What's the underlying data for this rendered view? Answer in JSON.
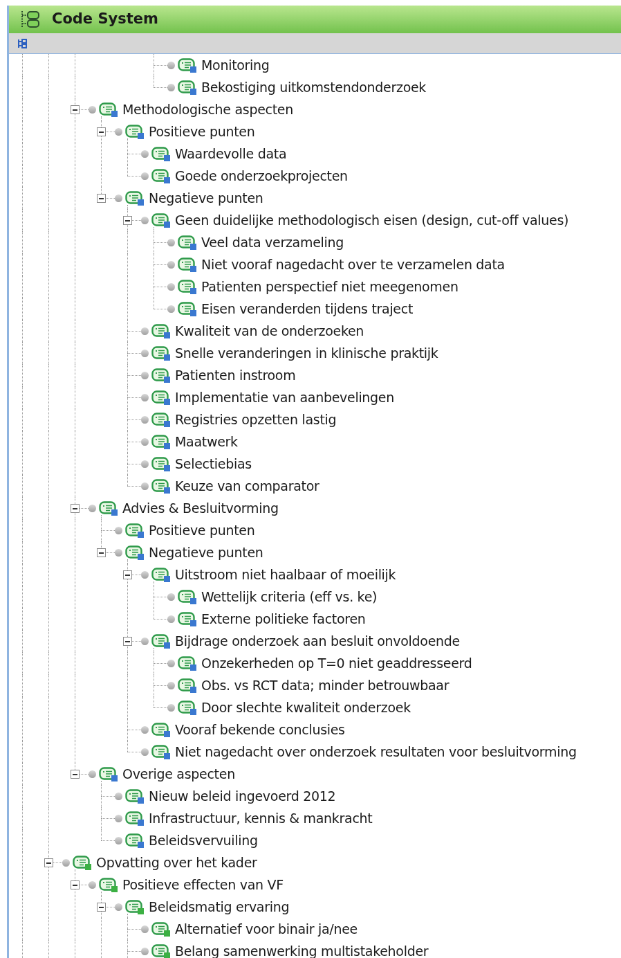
{
  "panel": {
    "title": "Code System"
  },
  "tree": [
    {
      "children": [
        {
          "children": [
            {
              "children": [
                {
                  "children": [
                    {
                      "children": [
                        {
                          "label": "Monitoring",
                          "color": "#3a78d0"
                        },
                        {
                          "label": "Bekostiging uitkomstendonderzoek",
                          "color": "#3a78d0"
                        }
                      ]
                    }
                  ]
                }
              ]
            },
            {
              "label": "Methodologische aspecten",
              "color": "#3a78d0",
              "expanded": true,
              "children": [
                {
                  "label": "Positieve punten",
                  "color": "#3a78d0",
                  "expanded": true,
                  "children": [
                    {
                      "label": "Waardevolle data",
                      "color": "#3a78d0"
                    },
                    {
                      "label": "Goede onderzoekprojecten",
                      "color": "#3a78d0"
                    }
                  ]
                },
                {
                  "label": "Negatieve punten",
                  "color": "#3a78d0",
                  "expanded": true,
                  "children": [
                    {
                      "label": "Geen duidelijke methodologisch eisen (design, cut-off values)",
                      "color": "#3a78d0",
                      "expanded": true,
                      "children": [
                        {
                          "label": "Veel data verzameling",
                          "color": "#3a78d0"
                        },
                        {
                          "label": "Niet vooraf nagedacht over te verzamelen data",
                          "color": "#3a78d0"
                        },
                        {
                          "label": "Patienten perspectief niet meegenomen",
                          "color": "#3a78d0"
                        },
                        {
                          "label": "Eisen veranderden tijdens traject",
                          "color": "#3a78d0"
                        }
                      ]
                    },
                    {
                      "label": "Kwaliteit van de onderzoeken",
                      "color": "#3a78d0"
                    },
                    {
                      "label": "Snelle veranderingen in klinische praktijk",
                      "color": "#3a78d0"
                    },
                    {
                      "label": "Patienten instroom",
                      "color": "#3a78d0"
                    },
                    {
                      "label": "Implementatie van aanbevelingen",
                      "color": "#3a78d0"
                    },
                    {
                      "label": "Registries opzetten lastig",
                      "color": "#3a78d0"
                    },
                    {
                      "label": "Maatwerk",
                      "color": "#3a78d0"
                    },
                    {
                      "label": "Selectiebias",
                      "color": "#3a78d0"
                    },
                    {
                      "label": "Keuze van comparator",
                      "color": "#3a78d0"
                    }
                  ]
                }
              ]
            },
            {
              "label": "Advies & Besluitvorming",
              "color": "#3a78d0",
              "expanded": true,
              "children": [
                {
                  "label": "Positieve punten",
                  "color": "#3a78d0"
                },
                {
                  "label": "Negatieve punten",
                  "color": "#3a78d0",
                  "expanded": true,
                  "children": [
                    {
                      "label": "Uitstroom niet haalbaar of moeilijk",
                      "color": "#3a78d0",
                      "expanded": true,
                      "children": [
                        {
                          "label": "Wettelijk criteria (eff vs. ke)",
                          "color": "#3a78d0"
                        },
                        {
                          "label": "Externe politieke factoren",
                          "color": "#3a78d0"
                        }
                      ]
                    },
                    {
                      "label": "Bijdrage onderzoek aan besluit onvoldoende",
                      "color": "#3a78d0",
                      "expanded": true,
                      "children": [
                        {
                          "label": "Onzekerheden op T=0 niet geaddresseerd",
                          "color": "#3a78d0"
                        },
                        {
                          "label": "Obs. vs RCT data; minder betrouwbaar",
                          "color": "#3a78d0"
                        },
                        {
                          "label": "Door slechte kwaliteit onderzoek",
                          "color": "#3a78d0"
                        }
                      ]
                    },
                    {
                      "label": "Vooraf bekende conclusies",
                      "color": "#3a78d0"
                    },
                    {
                      "label": "Niet nagedacht over onderzoek resultaten voor besluitvorming",
                      "color": "#3a78d0"
                    }
                  ]
                }
              ]
            },
            {
              "label": "Overige aspecten",
              "color": "#3a78d0",
              "expanded": true,
              "children": [
                {
                  "label": "Nieuw beleid ingevoerd 2012",
                  "color": "#3a78d0"
                },
                {
                  "label": "Infrastructuur, kennis & mankracht",
                  "color": "#3a78d0"
                },
                {
                  "label": "Beleidsvervuiling",
                  "color": "#3a78d0"
                }
              ]
            }
          ]
        },
        {
          "label": "Opvatting over het kader",
          "color": "#3cb043",
          "expanded": true,
          "children": [
            {
              "label": "Positieve effecten van VF",
              "color": "#3cb043",
              "expanded": true,
              "children": [
                {
                  "label": "Beleidsmatig ervaring",
                  "color": "#3cb043",
                  "expanded": true,
                  "children": [
                    {
                      "label": "Alternatief voor binair ja/nee",
                      "color": "#3cb043"
                    },
                    {
                      "label": "Belang samenwerking multistakeholder",
                      "color": "#3cb043"
                    }
                  ]
                }
              ]
            }
          ]
        }
      ]
    }
  ]
}
